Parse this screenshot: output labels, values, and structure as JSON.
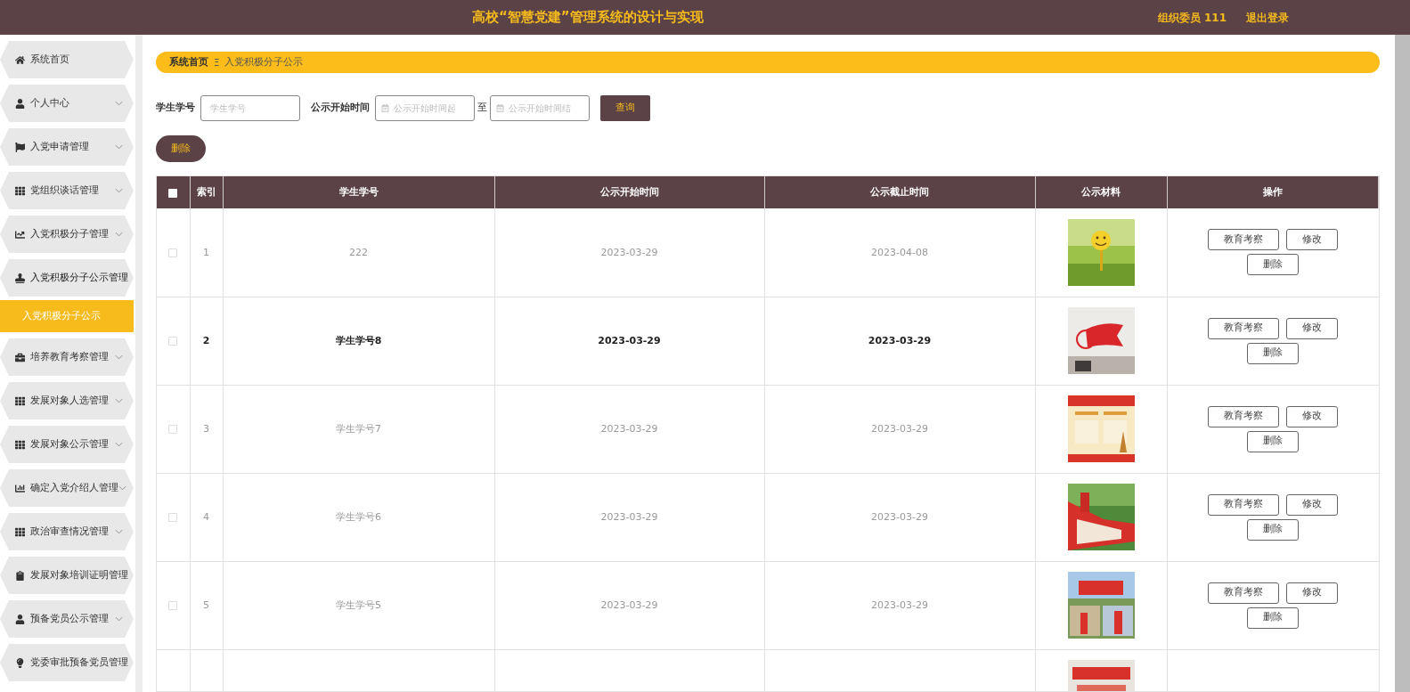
{
  "header": {
    "title": "高校“智慧党建”管理系统的设计与实现",
    "user": "组织委员 111",
    "logout": "退出登录"
  },
  "sidebar": {
    "items": [
      {
        "label": "系统首页",
        "expandable": false,
        "expanded": false
      },
      {
        "label": "个人中心",
        "expandable": true,
        "expanded": false
      },
      {
        "label": "入党申请管理",
        "expandable": true,
        "expanded": false
      },
      {
        "label": "党组织谈话管理",
        "expandable": true,
        "expanded": false
      },
      {
        "label": "入党积极分子管理",
        "expandable": true,
        "expanded": false
      },
      {
        "label": "入党积极分子公示管理",
        "expandable": false,
        "expanded": true,
        "children": [
          {
            "label": "入党积极分子公示",
            "selected": true
          }
        ]
      },
      {
        "label": "培养教育考察管理",
        "expandable": true,
        "expanded": false
      },
      {
        "label": "发展对象人选管理",
        "expandable": true,
        "expanded": false
      },
      {
        "label": "发展对象公示管理",
        "expandable": true,
        "expanded": false
      },
      {
        "label": "确定入党介绍人管理",
        "expandable": true,
        "expanded": false
      },
      {
        "label": "政治审查情况管理",
        "expandable": true,
        "expanded": false
      },
      {
        "label": "发展对象培训证明管理",
        "expandable": false,
        "expanded": false
      },
      {
        "label": "预备党员公示管理",
        "expandable": true,
        "expanded": false
      },
      {
        "label": "党委审批预备党员管理",
        "expandable": false,
        "expanded": false
      }
    ]
  },
  "breadcrumb": {
    "home": "系统首页",
    "separator": "Ξ",
    "current": "入党积极分子公示"
  },
  "search": {
    "id_label": "学生学号",
    "id_placeholder": "学生学号",
    "time_label": "公示开始时间",
    "start_placeholder": "公示开始时间起",
    "to": "至",
    "end_placeholder": "公示开始时间结",
    "query": "查询"
  },
  "delete_button": "删除",
  "table": {
    "header_checked": false,
    "columns": [
      "索引",
      "学生学号",
      "公示开始时间",
      "公示截止时间",
      "公示材料",
      "操作"
    ],
    "rows": [
      {
        "checked": false,
        "highlighted": false,
        "index": "1",
        "student_id": "222",
        "start": "2023-03-29",
        "end": "2023-04-08",
        "material": {
          "kind": "picture"
        },
        "actions": [
          "教育考察",
          "修改",
          "删除"
        ]
      },
      {
        "checked": false,
        "highlighted": true,
        "index": "2",
        "student_id": "学生学号8",
        "start": "2023-03-29",
        "end": "2023-03-29",
        "material": {
          "kind": "picture"
        },
        "actions": [
          "教育考察",
          "修改",
          "删除"
        ]
      },
      {
        "checked": false,
        "highlighted": false,
        "index": "3",
        "student_id": "学生学号7",
        "start": "2023-03-29",
        "end": "2023-03-29",
        "material": {
          "kind": "picture"
        },
        "actions": [
          "教育考察",
          "修改",
          "删除"
        ]
      },
      {
        "checked": false,
        "highlighted": false,
        "index": "4",
        "student_id": "学生学号6",
        "start": "2023-03-29",
        "end": "2023-03-29",
        "material": {
          "kind": "picture"
        },
        "actions": [
          "教育考察",
          "修改",
          "删除"
        ]
      },
      {
        "checked": false,
        "highlighted": false,
        "index": "5",
        "student_id": "学生学号5",
        "start": "2023-03-29",
        "end": "2023-03-29",
        "material": {
          "kind": "picture"
        },
        "actions": [
          "教育考察",
          "修改",
          "删除"
        ]
      },
      {
        "material": {
          "kind": "picture"
        }
      }
    ]
  }
}
